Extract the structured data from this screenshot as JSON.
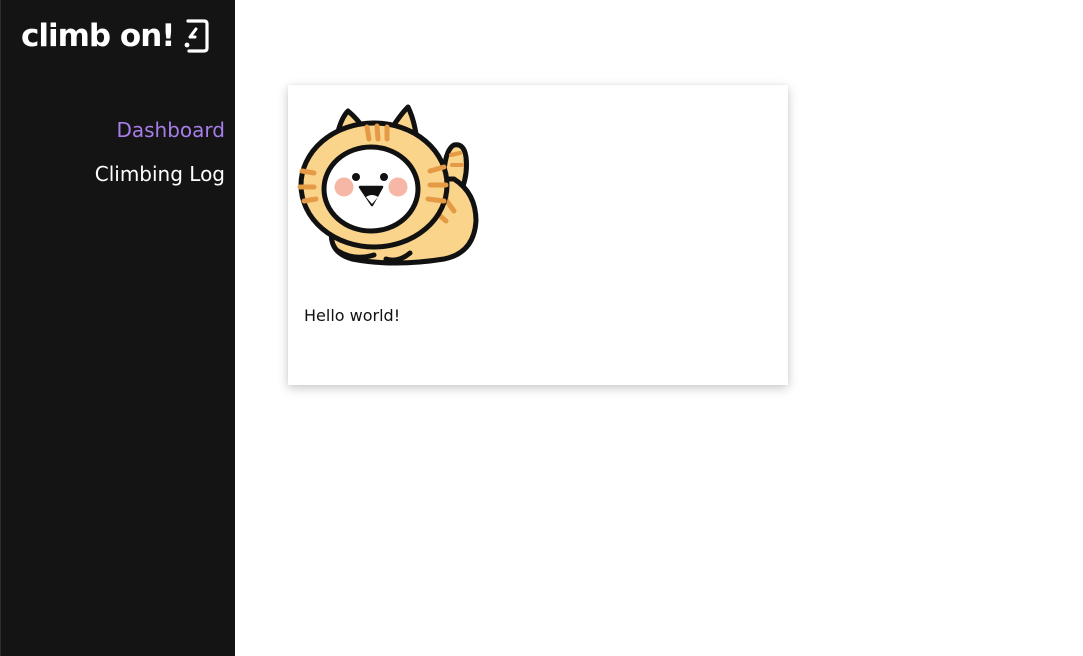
{
  "sidebar": {
    "brand": {
      "title": "climb on!",
      "icon": "climbing-hold-icon"
    },
    "nav_items": [
      {
        "label": "Dashboard",
        "active": true
      },
      {
        "label": "Climbing Log",
        "active": false
      }
    ]
  },
  "main": {
    "card": {
      "image": "cat-costume-illustration",
      "text": "Hello world!"
    }
  },
  "colors": {
    "sidebar_bg": "#141414",
    "accent": "#a77de8",
    "nav_text": "#ffffff",
    "cat_fur": "#f9d48a",
    "cat_stripe": "#e59a45",
    "cheeks": "#f7b7a6"
  }
}
